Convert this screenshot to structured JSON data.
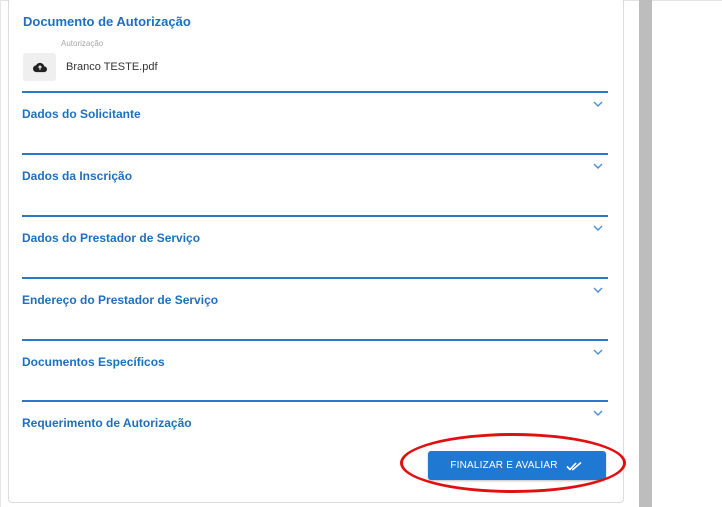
{
  "form": {
    "authorization_doc_title": "Documento de Autorização",
    "file": {
      "caption": "Autorização",
      "name": "Branco TESTE.pdf",
      "upload_icon": "cloud-upload-icon"
    },
    "sections": [
      {
        "label": "Dados do Solicitante",
        "icon": "chevron-down-icon"
      },
      {
        "label": "Dados da Inscrição",
        "icon": "chevron-down-icon"
      },
      {
        "label": "Dados do Prestador de Serviço",
        "icon": "chevron-down-icon"
      },
      {
        "label": "Endereço do Prestador de Serviço",
        "icon": "chevron-down-icon"
      },
      {
        "label": "Documentos Específicos",
        "icon": "chevron-down-icon"
      },
      {
        "label": "Requerimento de Autorização",
        "icon": "chevron-down-icon"
      }
    ],
    "finalize_button": {
      "label": "FINALIZAR E AVALIAR",
      "icon": "double-check-icon"
    }
  },
  "colors": {
    "accent": "#1f6fbd",
    "rule": "#2b78c9",
    "button": "#1f78d1",
    "annotation": "#e10f12"
  }
}
